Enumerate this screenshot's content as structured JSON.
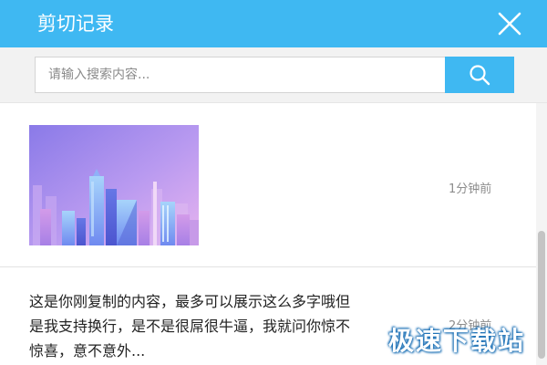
{
  "window": {
    "title": "剪切记录"
  },
  "search": {
    "placeholder": "请输入搜索内容..."
  },
  "items": [
    {
      "type": "image",
      "time": "1分钟前"
    },
    {
      "type": "text",
      "text": "这是你刚复制的内容，最多可以展示这么多字哦但\n是我支持换行，是不是很屌很牛逼，我就问你惊不\n惊喜，意不意外...",
      "time": "2分钟前"
    }
  ],
  "watermark": "极速下载站",
  "colors": {
    "accent": "#3fb8f2"
  },
  "icons": {
    "close": "close-icon",
    "search": "search-icon"
  }
}
